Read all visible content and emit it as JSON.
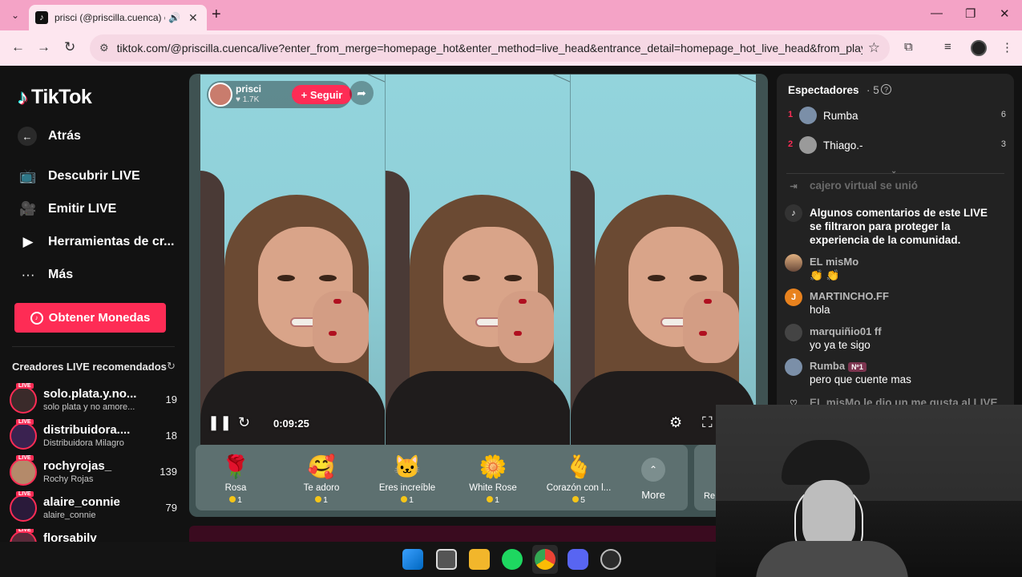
{
  "browser": {
    "tab_title": "prisci (@priscilla.cuenca) est",
    "url": "tiktok.com/@priscilla.cuenca/live?enter_from_merge=homepage_hot&enter_method=live_head&entrance_detail=homepage_hot_live_head&from_play_mode..."
  },
  "sidebar": {
    "logo": "TikTok",
    "back": "Atrás",
    "nav": [
      {
        "label": "Descubrir LIVE",
        "icon": "tv-icon"
      },
      {
        "label": "Emitir LIVE",
        "icon": "camera-icon"
      },
      {
        "label": "Herramientas de cr...",
        "icon": "play-circle-icon"
      },
      {
        "label": "Más",
        "icon": "more-icon"
      }
    ],
    "coins_button": "Obtener Monedas",
    "recommended_title": "Creadores LIVE recomendados",
    "live_badge": "LIVE",
    "creators": [
      {
        "name": "solo.plata.y.no...",
        "sub": "solo plata y no amore...",
        "count": "19"
      },
      {
        "name": "distribuidora....",
        "sub": "Distribuidora Milagro",
        "count": "18"
      },
      {
        "name": "rochyrojas_",
        "sub": "Rochy Rojas",
        "count": "139"
      },
      {
        "name": "alaire_connie",
        "sub": "alaire_connie",
        "count": "79"
      },
      {
        "name": "florsabilv",
        "sub": "",
        "count": ""
      }
    ]
  },
  "live": {
    "streamer_name": "prisci",
    "likes": "♥ 1.7K",
    "follow_label": "+ Seguir",
    "time": "0:09:25"
  },
  "gifts": [
    {
      "name": "Rosa",
      "price": "1",
      "icon": "🌹"
    },
    {
      "name": "Te adoro",
      "price": "1",
      "icon": "🥰"
    },
    {
      "name": "Eres increíble",
      "price": "1",
      "icon": "🐱"
    },
    {
      "name": "White Rose",
      "price": "1",
      "icon": "🌼"
    },
    {
      "name": "Corazón con l...",
      "price": "5",
      "icon": "🫰"
    }
  ],
  "gift_more": "More",
  "gift_extra": "Re",
  "chat": {
    "viewers_title": "Espectadores",
    "viewers_count": "· 5",
    "viewers": [
      {
        "rank": "1",
        "name": "Rumba",
        "score": "6"
      },
      {
        "rank": "2",
        "name": "Thiago.-",
        "score": "3"
      }
    ],
    "messages": [
      {
        "type": "join",
        "name": "",
        "text": "cajero virtual  se unió"
      },
      {
        "type": "system",
        "name": "",
        "text": "Algunos comentarios de este LIVE se filtraron para proteger la experiencia de la comunidad."
      },
      {
        "type": "chat",
        "name": "EL misMo",
        "text": "👏 👏",
        "avatar": "",
        "badge": ""
      },
      {
        "type": "chat",
        "name": "MARTINCHO.FF",
        "text": "hola",
        "avatar": "J",
        "badge": ""
      },
      {
        "type": "chat",
        "name": "marquiñio01 ff",
        "text": "yo ya te sigo",
        "avatar": "",
        "badge": ""
      },
      {
        "type": "chat",
        "name": "Rumba",
        "text": "pero que cuente mas",
        "avatar": "",
        "badge": "Nº1"
      },
      {
        "type": "like",
        "name": "",
        "text": "EL misMo le dio un me gusta al LIVE"
      }
    ]
  }
}
